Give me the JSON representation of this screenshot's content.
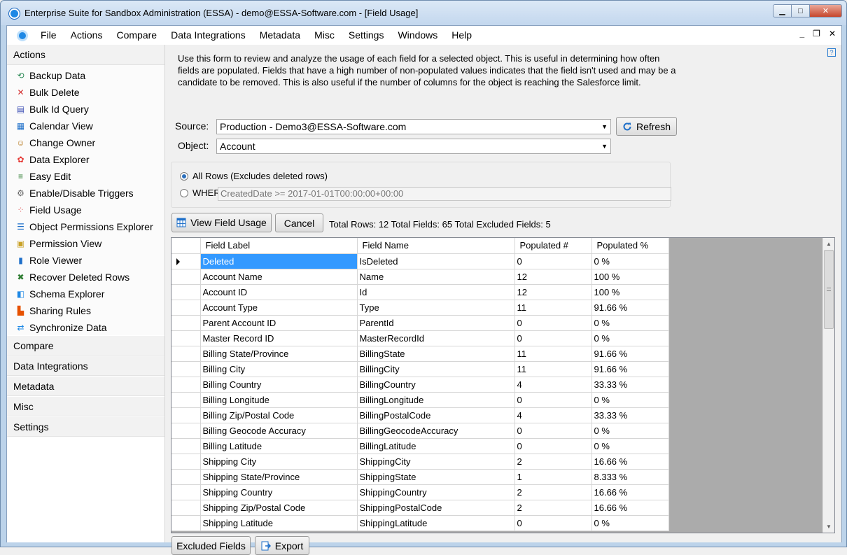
{
  "window": {
    "title": "Enterprise Suite for Sandbox Administration (ESSA) - demo@ESSA-Software.com - [Field Usage]",
    "min_glyph": "▁",
    "max_glyph": "□",
    "close_glyph": "✕"
  },
  "menubar": {
    "items": [
      "File",
      "Actions",
      "Compare",
      "Data Integrations",
      "Metadata",
      "Misc",
      "Settings",
      "Windows",
      "Help"
    ],
    "right_min": "_",
    "right_restore": "❐",
    "right_close": "✕"
  },
  "sidebar": {
    "header": "Actions",
    "items": [
      {
        "label": "Backup Data",
        "icon": "backup-icon"
      },
      {
        "label": "Bulk Delete",
        "icon": "red-x-icon"
      },
      {
        "label": "Bulk Id Query",
        "icon": "query-icon"
      },
      {
        "label": "Calendar View",
        "icon": "calendar-icon"
      },
      {
        "label": "Change Owner",
        "icon": "people-icon"
      },
      {
        "label": "Data Explorer",
        "icon": "color-wheel-icon"
      },
      {
        "label": "Easy Edit",
        "icon": "edit-list-icon"
      },
      {
        "label": "Enable/Disable Triggers",
        "icon": "trigger-icon"
      },
      {
        "label": "Field Usage",
        "icon": "dots-icon"
      },
      {
        "label": "Object Permissions Explorer",
        "icon": "list-icon"
      },
      {
        "label": "Permission View",
        "icon": "permission-icon"
      },
      {
        "label": "Role Viewer",
        "icon": "role-icon"
      },
      {
        "label": "Recover Deleted Rows",
        "icon": "recover-icon"
      },
      {
        "label": "Schema Explorer",
        "icon": "schema-icon"
      },
      {
        "label": "Sharing Rules",
        "icon": "sharing-icon"
      },
      {
        "label": "Synchronize Data",
        "icon": "sync-icon"
      }
    ],
    "sections": [
      "Compare",
      "Data Integrations",
      "Metadata",
      "Misc",
      "Settings"
    ]
  },
  "form": {
    "help_glyph": "?",
    "description": "Use this form to review and analyze the usage of each field for a selected object. This is useful in determining how often fields are populated. Fields that have a high number of non-populated values indicates that the field isn't used and may be a candidate to be removed. This is also useful if the number of columns for the object is reaching the Salesforce limit.",
    "source_label": "Source:",
    "source_value": "Production - Demo3@ESSA-Software.com",
    "refresh_label": "Refresh",
    "object_label": "Object:",
    "object_value": "Account",
    "radio_all_label": "All Rows (Excludes deleted rows)",
    "radio_where_label": "WHERE",
    "where_value": "CreatedDate >= 2017-01-01T00:00:00+00:00",
    "view_button": "View Field Usage",
    "cancel_button": "Cancel",
    "summary": "Total Rows: 12 Total Fields: 65 Total Excluded Fields: 5",
    "excluded_button": "Excluded Fields",
    "export_button": "Export"
  },
  "grid": {
    "columns": [
      "Field Label",
      "Field Name",
      "Populated #",
      "Populated %"
    ],
    "rows": [
      [
        "Deleted",
        "IsDeleted",
        "0",
        "0 %"
      ],
      [
        "Account Name",
        "Name",
        "12",
        "100 %"
      ],
      [
        "Account ID",
        "Id",
        "12",
        "100 %"
      ],
      [
        "Account Type",
        "Type",
        "11",
        "91.66 %"
      ],
      [
        "Parent Account ID",
        "ParentId",
        "0",
        "0 %"
      ],
      [
        "Master Record ID",
        "MasterRecordId",
        "0",
        "0 %"
      ],
      [
        "Billing State/Province",
        "BillingState",
        "11",
        "91.66 %"
      ],
      [
        "Billing City",
        "BillingCity",
        "11",
        "91.66 %"
      ],
      [
        "Billing Country",
        "BillingCountry",
        "4",
        "33.33 %"
      ],
      [
        "Billing Longitude",
        "BillingLongitude",
        "0",
        "0 %"
      ],
      [
        "Billing Zip/Postal Code",
        "BillingPostalCode",
        "4",
        "33.33 %"
      ],
      [
        "Billing Geocode Accuracy",
        "BillingGeocodeAccuracy",
        "0",
        "0 %"
      ],
      [
        "Billing Latitude",
        "BillingLatitude",
        "0",
        "0 %"
      ],
      [
        "Shipping City",
        "ShippingCity",
        "2",
        "16.66 %"
      ],
      [
        "Shipping State/Province",
        "ShippingState",
        "1",
        "8.333 %"
      ],
      [
        "Shipping Country",
        "ShippingCountry",
        "2",
        "16.66 %"
      ],
      [
        "Shipping Zip/Postal Code",
        "ShippingPostalCode",
        "2",
        "16.66 %"
      ],
      [
        "Shipping Latitude",
        "ShippingLatitude",
        "0",
        "0 %"
      ]
    ],
    "scroll_up": "▲",
    "scroll_down": "▼"
  }
}
